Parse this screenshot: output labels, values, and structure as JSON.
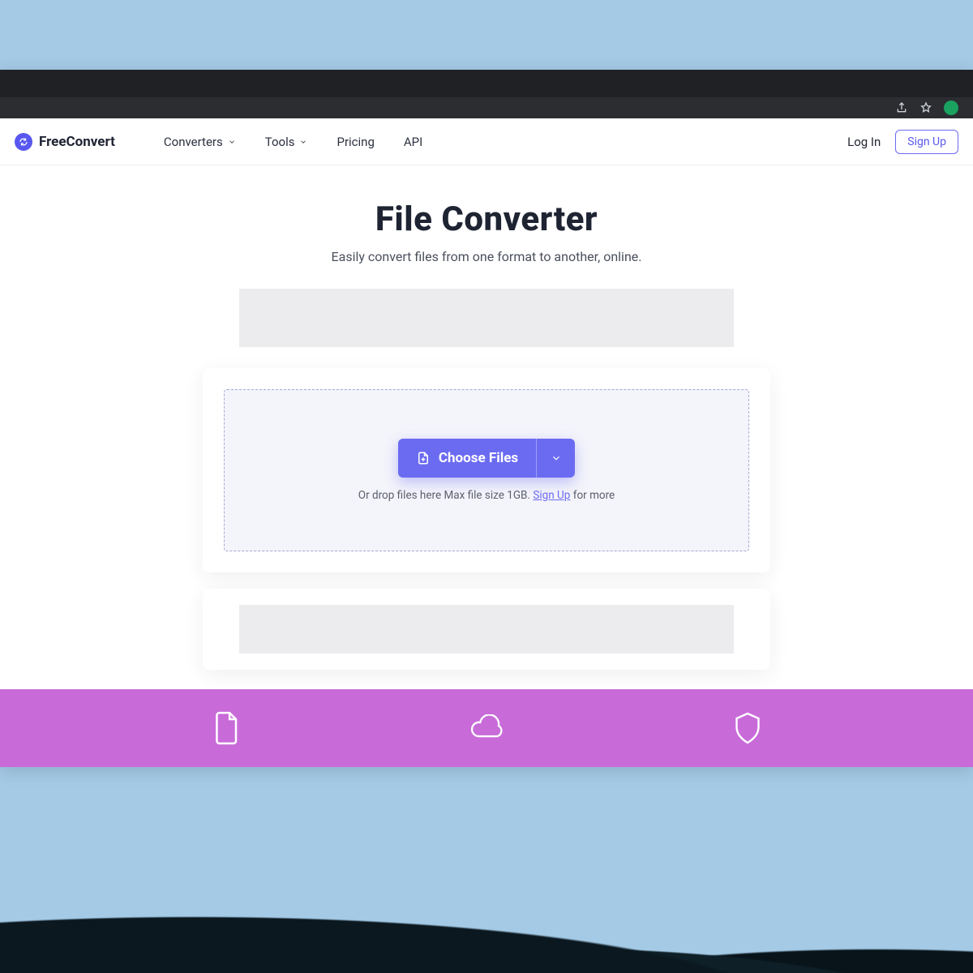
{
  "brand": {
    "name": "FreeConvert"
  },
  "nav": {
    "items": [
      {
        "label": "Converters",
        "has_dropdown": true
      },
      {
        "label": "Tools",
        "has_dropdown": true
      },
      {
        "label": "Pricing",
        "has_dropdown": false
      },
      {
        "label": "API",
        "has_dropdown": false
      }
    ],
    "login_label": "Log In",
    "signup_label": "Sign Up"
  },
  "hero": {
    "title": "File Converter",
    "subtitle": "Easily convert files from one format to another, online."
  },
  "upload": {
    "choose_label": "Choose Files",
    "hint_pre": "Or drop files here Max file size 1GB. ",
    "hint_link": "Sign Up",
    "hint_post": " for more"
  },
  "colors": {
    "accent": "#6b6bf2",
    "band": "#c86bd9"
  }
}
